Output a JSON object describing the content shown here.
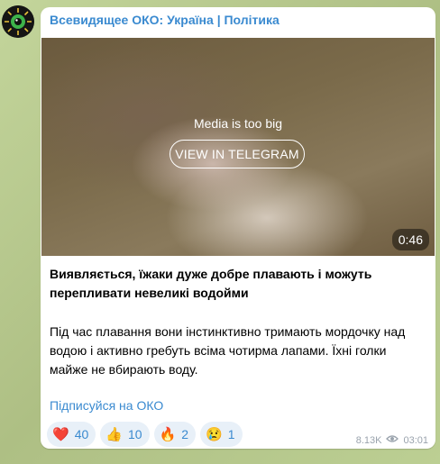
{
  "channel": {
    "name": "Всевидящее ОКО: Україна | Політика"
  },
  "media": {
    "message": "Media is too big",
    "button_label": "VIEW IN TELEGRAM",
    "duration": "0:46"
  },
  "post": {
    "title": "Виявляється, їжаки дуже добре плавають і можуть перепливати невеликі водойми",
    "body": "Під час плавання вони інстинктивно тримають мордочку над водою і активно гребуть всіма чотирма лапами. Їхні голки майже не вбирають воду.",
    "link": "Підписуйся на ОКО"
  },
  "reactions": [
    {
      "icon": "red-heart-icon",
      "emoji": "❤️",
      "count": "40"
    },
    {
      "icon": "thumbs-up-icon",
      "emoji": "👍",
      "count": "10"
    },
    {
      "icon": "fire-icon",
      "emoji": "🔥",
      "count": "2"
    },
    {
      "icon": "crying-face-icon",
      "emoji": "😢",
      "count": "1"
    }
  ],
  "meta": {
    "views": "8.13K",
    "time": "03:01"
  },
  "colors": {
    "accent": "#3a8ad0",
    "reaction_bg": "#e8f0f8",
    "background": "#b7c98f"
  }
}
